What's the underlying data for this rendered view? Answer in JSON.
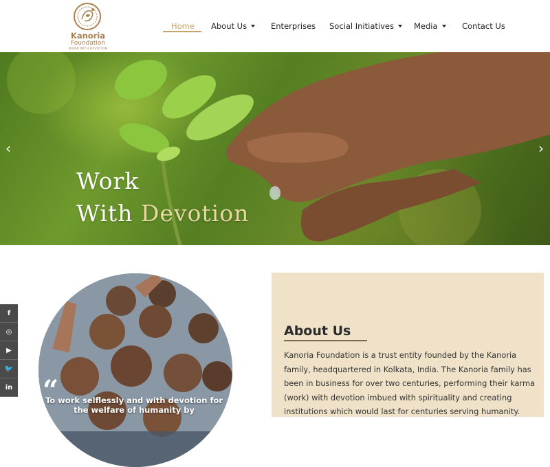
{
  "logo": {
    "name": "Kanoria",
    "subtitle": "Foundation",
    "tagline": "WORK WITH DEVOTION"
  },
  "nav": {
    "items": [
      {
        "label": "Home",
        "active": true,
        "dropdown": false
      },
      {
        "label": "About Us",
        "active": false,
        "dropdown": true
      },
      {
        "label": "Enterprises",
        "active": false,
        "dropdown": false
      },
      {
        "label": "Social Initiatives",
        "active": false,
        "dropdown": true
      },
      {
        "label": "Media",
        "active": false,
        "dropdown": true
      },
      {
        "label": "Contact Us",
        "active": false,
        "dropdown": false
      }
    ]
  },
  "hero": {
    "line1": "Work",
    "line2_prefix": "With ",
    "line2_accent": "Devotion",
    "prev_icon": "chevron-left-icon",
    "next_icon": "chevron-right-icon",
    "prev_glyph": "‹",
    "next_glyph": "›"
  },
  "social": [
    {
      "icon": "facebook-icon",
      "glyph": "f"
    },
    {
      "icon": "instagram-icon",
      "glyph": "◎"
    },
    {
      "icon": "youtube-icon",
      "glyph": "▶"
    },
    {
      "icon": "twitter-icon",
      "glyph": "🐦"
    },
    {
      "icon": "linkedin-icon",
      "glyph": "in"
    }
  ],
  "quote": {
    "mark": "“",
    "text": "To work selflessly and with devotion for the welfare of humanity by"
  },
  "about": {
    "title": "About Us",
    "text": "Kanoria Foundation is a trust entity founded by the Kanoria family, headquartered in Kolkata, India. The Kanoria family has been in business for over two centuries, performing their karma (work) with devotion imbued with spirituality and creating institutions which would last for centuries serving humanity."
  },
  "colors": {
    "accent": "#c8a46a",
    "about_bg": "#efe2c8",
    "hero_accent_text": "#e8d9a4",
    "social_bg": "#4a4a4a"
  }
}
